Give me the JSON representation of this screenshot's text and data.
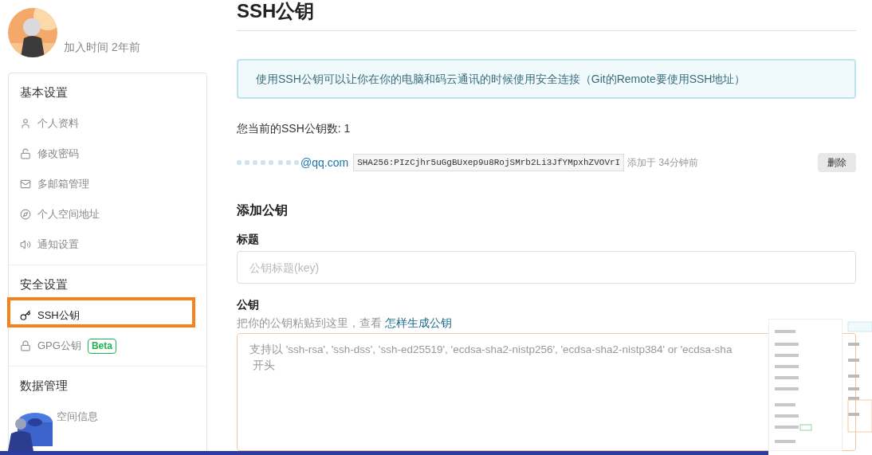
{
  "user": {
    "joined": "加入时间 2年前"
  },
  "sidebar": {
    "sections": [
      {
        "title": "基本设置",
        "items": [
          {
            "label": "个人资料",
            "kind": "user",
            "selected": false,
            "highlighted": false
          },
          {
            "label": "修改密码",
            "kind": "unlock",
            "selected": false,
            "highlighted": false
          },
          {
            "label": "多邮箱管理",
            "kind": "mail",
            "selected": false,
            "highlighted": false
          },
          {
            "label": "个人空间地址",
            "kind": "compass",
            "selected": false,
            "highlighted": false
          },
          {
            "label": "通知设置",
            "kind": "volume",
            "selected": false,
            "highlighted": false
          }
        ]
      },
      {
        "title": "安全设置",
        "items": [
          {
            "label": "SSH公钥",
            "kind": "key",
            "selected": true,
            "highlighted": true
          },
          {
            "label": "GPG公钥",
            "kind": "lock",
            "badge": "Beta",
            "selected": false,
            "highlighted": false
          }
        ]
      },
      {
        "title": "数据管理",
        "items": [
          {
            "label": "空间信息",
            "kind": "plain",
            "selected": false,
            "highlighted": false
          }
        ]
      }
    ]
  },
  "page": {
    "title": "SSH公钥",
    "notice": "使用SSH公钥可以让你在你的电脑和码云通讯的时候使用安全连接（Git的Remote要使用SSH地址）",
    "key_count": "您当前的SSH公钥数: 1",
    "keys": [
      {
        "email": "@qq.com",
        "fingerprint": "SHA256:PIzCjhr5uGgBUxep9u8RojSMrb2Li3JfYMpxhZVOVrI",
        "added": "添加于 34分钟前",
        "delete": "删除"
      }
    ],
    "add": {
      "heading": "添加公钥",
      "title_label": "标题",
      "title_placeholder": "公钥标题(key)",
      "key_label": "公钥",
      "help": "把你的公钥粘贴到这里，查看",
      "help_link": "怎样生成公钥",
      "key_placeholder": [
        "支持以 'ssh-rsa', 'ssh-dss', 'ssh-ed25519', 'ecdsa-sha2-nistp256', 'ecdsa-sha2-nistp384' or 'ecdsa-sha",
        " 开头"
      ]
    }
  }
}
